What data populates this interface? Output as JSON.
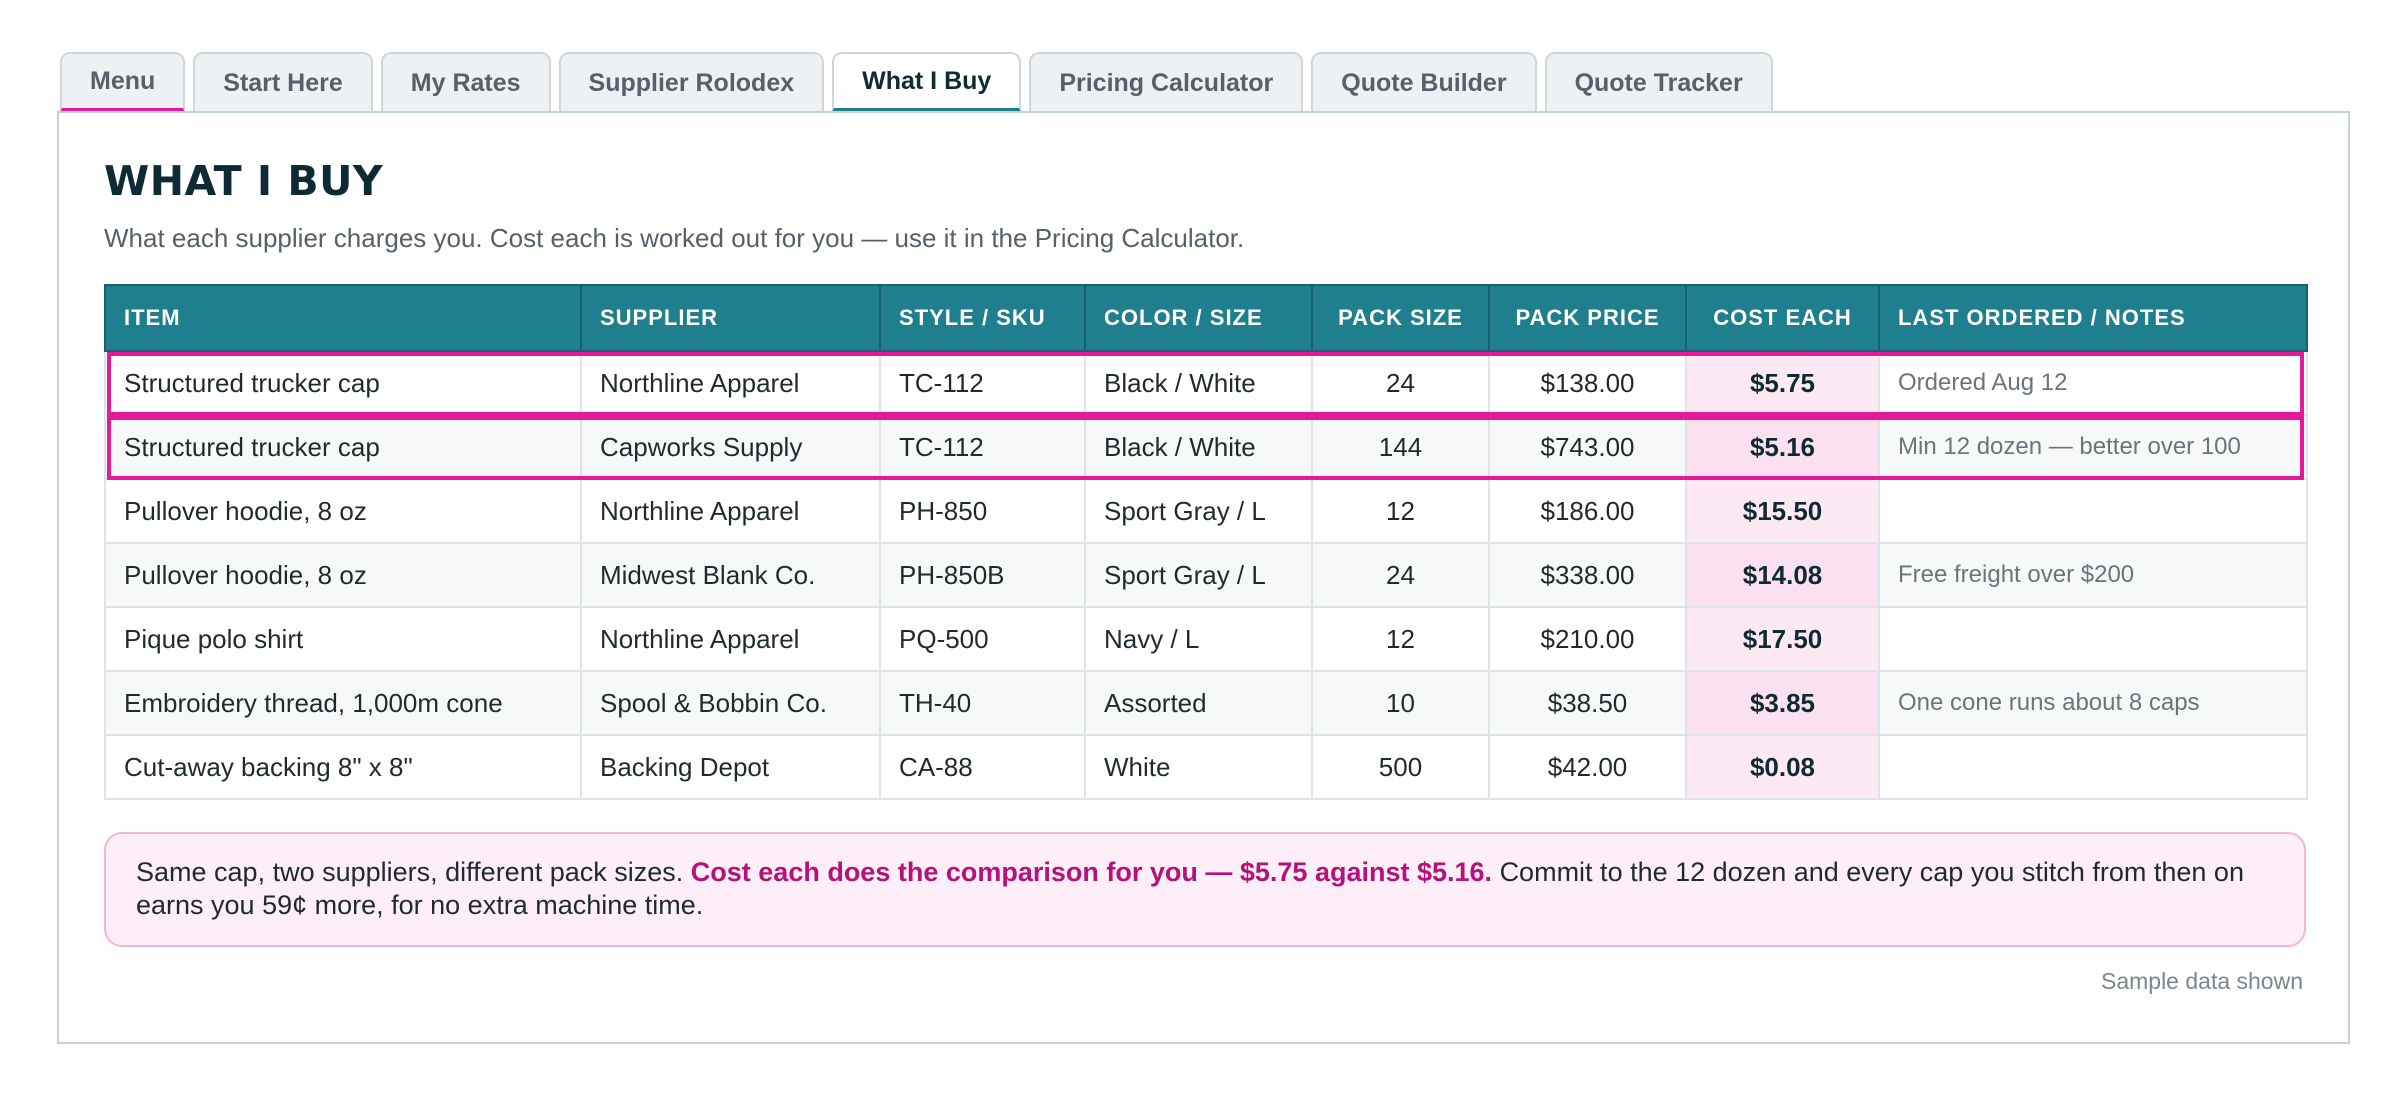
{
  "tabs": [
    {
      "label": "Menu"
    },
    {
      "label": "Start Here"
    },
    {
      "label": "My Rates"
    },
    {
      "label": "Supplier Rolodex"
    },
    {
      "label": "What I Buy"
    },
    {
      "label": "Pricing Calculator"
    },
    {
      "label": "Quote Builder"
    },
    {
      "label": "Quote Tracker"
    }
  ],
  "active_tab": "What I Buy",
  "page": {
    "title": "WHAT I BUY",
    "subtitle": "What each supplier charges you. Cost each is worked out for you — use it in the Pricing Calculator."
  },
  "table": {
    "headers": [
      "ITEM",
      "SUPPLIER",
      "STYLE / SKU",
      "COLOR / SIZE",
      "PACK SIZE",
      "PACK PRICE",
      "COST EACH",
      "LAST ORDERED / NOTES"
    ],
    "rows": [
      {
        "item": "Structured trucker cap",
        "supplier": "Northline Apparel",
        "sku": "TC-112",
        "color_size": "Black / White",
        "pack_size": "24",
        "pack_price": "$138.00",
        "cost_each": "$5.75",
        "notes": "Ordered Aug 12",
        "highlighted": true
      },
      {
        "item": "Structured trucker cap",
        "supplier": "Capworks Supply",
        "sku": "TC-112",
        "color_size": "Black / White",
        "pack_size": "144",
        "pack_price": "$743.00",
        "cost_each": "$5.16",
        "notes": "Min 12 dozen — better over 100",
        "highlighted": true
      },
      {
        "item": "Pullover hoodie, 8 oz",
        "supplier": "Northline Apparel",
        "sku": "PH-850",
        "color_size": "Sport Gray / L",
        "pack_size": "12",
        "pack_price": "$186.00",
        "cost_each": "$15.50",
        "notes": ""
      },
      {
        "item": "Pullover hoodie, 8 oz",
        "supplier": "Midwest Blank Co.",
        "sku": "PH-850B",
        "color_size": "Sport Gray / L",
        "pack_size": "24",
        "pack_price": "$338.00",
        "cost_each": "$14.08",
        "notes": "Free freight over $200"
      },
      {
        "item": "Pique polo shirt",
        "supplier": "Northline Apparel",
        "sku": "PQ-500",
        "color_size": "Navy / L",
        "pack_size": "12",
        "pack_price": "$210.00",
        "cost_each": "$17.50",
        "notes": ""
      },
      {
        "item": "Embroidery thread, 1,000m cone",
        "supplier": "Spool & Bobbin Co.",
        "sku": "TH-40",
        "color_size": "Assorted",
        "pack_size": "10",
        "pack_price": "$38.50",
        "cost_each": "$3.85",
        "notes": "One cone runs about 8 caps"
      },
      {
        "item": "Cut-away backing 8\" x 8\"",
        "supplier": "Backing Depot",
        "sku": "CA-88",
        "color_size": "White",
        "pack_size": "500",
        "pack_price": "$42.00",
        "cost_each": "$0.08",
        "notes": ""
      }
    ]
  },
  "callout": {
    "lead": "Same cap, two suppliers, different pack sizes.",
    "emphasis": "Cost each does the comparison for you — $5.75 against $5.16.",
    "tail": "Commit to the 12 dozen and every cap you stitch from then on earns you 59¢ more, for no extra machine time."
  },
  "footnote": "Sample data shown",
  "colors": {
    "accent_teal": "#1f7f8e",
    "highlight_pink": "#e6199a",
    "cost_cell_bg": "#fde9f4",
    "callout_emphasis": "#b5117a"
  }
}
